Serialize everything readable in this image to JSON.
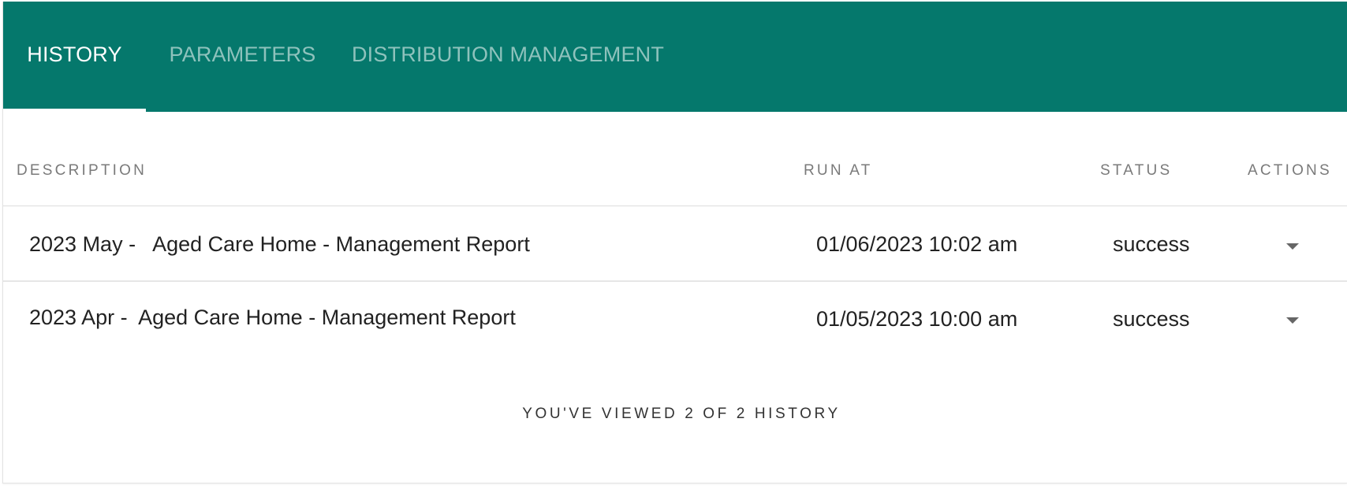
{
  "tabs": [
    {
      "label": "HISTORY",
      "active": true
    },
    {
      "label": "PARAMETERS",
      "active": false
    },
    {
      "label": "DISTRIBUTION MANAGEMENT",
      "active": false
    }
  ],
  "table": {
    "headers": {
      "description": "DESCRIPTION",
      "run_at": "RUN AT",
      "status": "STATUS",
      "actions": "ACTIONS"
    },
    "rows": [
      {
        "description": "2023 May -   Aged Care Home - Management Report",
        "run_at": "01/06/2023 10:02 am",
        "status": "success",
        "action_icon": "caret-down-icon"
      },
      {
        "description": "2023 Apr -  Aged Care Home - Management Report",
        "run_at": "01/05/2023 10:00 am",
        "status": "success",
        "action_icon": "caret-down-icon"
      }
    ]
  },
  "footer": {
    "text": "YOU'VE VIEWED 2 OF 2 HISTORY"
  },
  "colors": {
    "tabbar": "#05786c",
    "active_tab": "#ffffff",
    "inactive_tab": "#8fc9c1"
  }
}
